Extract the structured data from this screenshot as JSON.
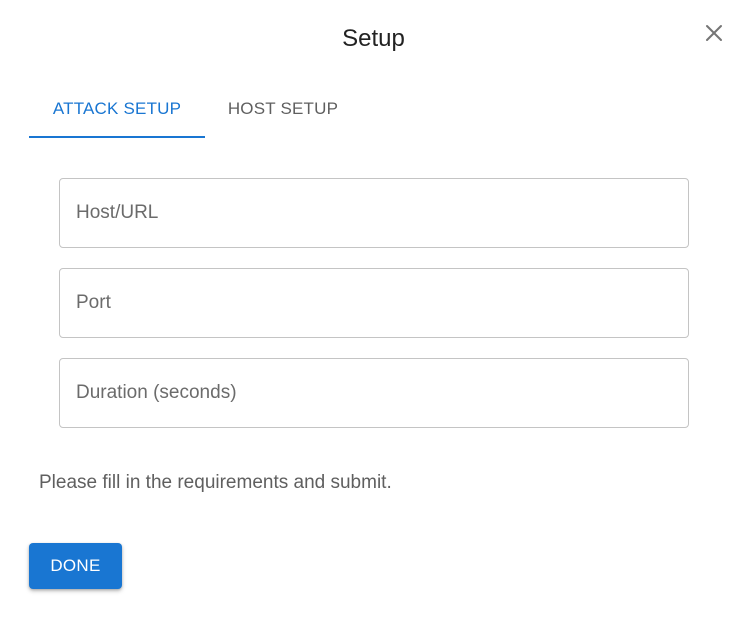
{
  "dialog": {
    "title": "Setup",
    "close_icon": "close-icon"
  },
  "tabs": [
    {
      "label": "ATTACK SETUP",
      "active": true
    },
    {
      "label": "HOST SETUP",
      "active": false
    }
  ],
  "form": {
    "host": {
      "placeholder": "Host/URL",
      "value": ""
    },
    "port": {
      "placeholder": "Port",
      "value": ""
    },
    "duration": {
      "placeholder": "Duration (seconds)",
      "value": ""
    }
  },
  "message": "Please fill in the requirements and submit.",
  "actions": {
    "done_label": "DONE"
  },
  "colors": {
    "accent": "#1976d2",
    "text_muted": "#5f5f5f",
    "border": "#c4c4c4"
  }
}
